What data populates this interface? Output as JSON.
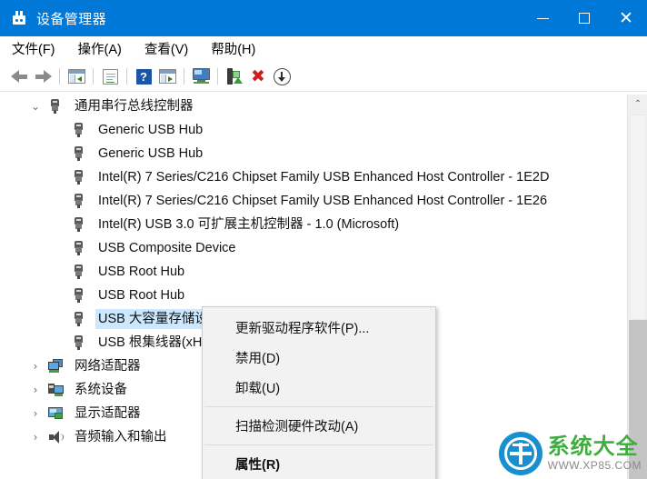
{
  "window": {
    "title": "设备管理器",
    "icon": "device-plug-icon",
    "accent_color": "#0078d7",
    "controls": {
      "minimize": "−",
      "maximize": "□",
      "close": "✕"
    }
  },
  "menubar": {
    "items": [
      {
        "label": "文件(F)",
        "name": "menu-file"
      },
      {
        "label": "操作(A)",
        "name": "menu-action"
      },
      {
        "label": "查看(V)",
        "name": "menu-view"
      },
      {
        "label": "帮助(H)",
        "name": "menu-help"
      }
    ]
  },
  "toolbar": {
    "items": [
      {
        "icon": "back-arrow-icon"
      },
      {
        "icon": "forward-arrow-icon"
      },
      {
        "icon": "separator"
      },
      {
        "icon": "show-hidden-devices-icon"
      },
      {
        "icon": "separator"
      },
      {
        "icon": "properties-icon"
      },
      {
        "icon": "separator"
      },
      {
        "icon": "help-icon",
        "glyph": "?"
      },
      {
        "icon": "device-list-icon"
      },
      {
        "icon": "separator"
      },
      {
        "icon": "scan-hardware-icon"
      },
      {
        "icon": "separator"
      },
      {
        "icon": "update-driver-icon"
      },
      {
        "icon": "uninstall-device-icon",
        "glyph": "✖"
      },
      {
        "icon": "download-icon"
      }
    ]
  },
  "tree": {
    "root": {
      "label": "通用串行总线控制器",
      "expanded": true,
      "chevron": "⌄",
      "icon": "usb-icon"
    },
    "children": [
      {
        "label": "Generic USB Hub",
        "icon": "usb-icon",
        "selected": false
      },
      {
        "label": "Generic USB Hub",
        "icon": "usb-icon",
        "selected": false
      },
      {
        "label": "Intel(R) 7 Series/C216 Chipset Family USB Enhanced Host Controller - 1E2D",
        "icon": "usb-icon",
        "selected": false
      },
      {
        "label": "Intel(R) 7 Series/C216 Chipset Family USB Enhanced Host Controller - 1E26",
        "icon": "usb-icon",
        "selected": false
      },
      {
        "label": "Intel(R) USB 3.0 可扩展主机控制器 - 1.0 (Microsoft)",
        "icon": "usb-icon",
        "selected": false
      },
      {
        "label": "USB Composite Device",
        "icon": "usb-icon",
        "selected": false
      },
      {
        "label": "USB Root Hub",
        "icon": "usb-icon",
        "selected": false
      },
      {
        "label": "USB Root Hub",
        "icon": "usb-icon",
        "selected": false
      },
      {
        "label": "USB 大容量存储设备",
        "icon": "usb-icon",
        "selected": true
      },
      {
        "label": "USB 根集线器(xHCI)",
        "icon": "usb-icon",
        "selected": false
      }
    ],
    "categories": [
      {
        "label": "网络适配器",
        "chevron": "›",
        "icon": "network-adapter-icon"
      },
      {
        "label": "系统设备",
        "chevron": "›",
        "icon": "system-devices-icon"
      },
      {
        "label": "显示适配器",
        "chevron": "›",
        "icon": "display-adapter-icon"
      },
      {
        "label": "音频输入和输出",
        "chevron": "›",
        "icon": "audio-io-icon"
      }
    ]
  },
  "scrollbar": {
    "up_arrow": "⌃"
  },
  "context_menu": {
    "items": [
      {
        "label": "更新驱动程序软件(P)...",
        "name": "ctx-update-driver",
        "bold": false
      },
      {
        "label": "禁用(D)",
        "name": "ctx-disable",
        "bold": false
      },
      {
        "label": "卸载(U)",
        "name": "ctx-uninstall",
        "bold": false
      },
      {
        "label": "扫描检测硬件改动(A)",
        "name": "ctx-scan-hardware",
        "bold": false
      },
      {
        "label": "属性(R)",
        "name": "ctx-properties",
        "bold": true
      }
    ]
  },
  "watermark": {
    "title": "系统大全",
    "url": "WWW.XP85.COM",
    "title_color": "#3fae3f",
    "logo_color": "#1a8fd0"
  }
}
